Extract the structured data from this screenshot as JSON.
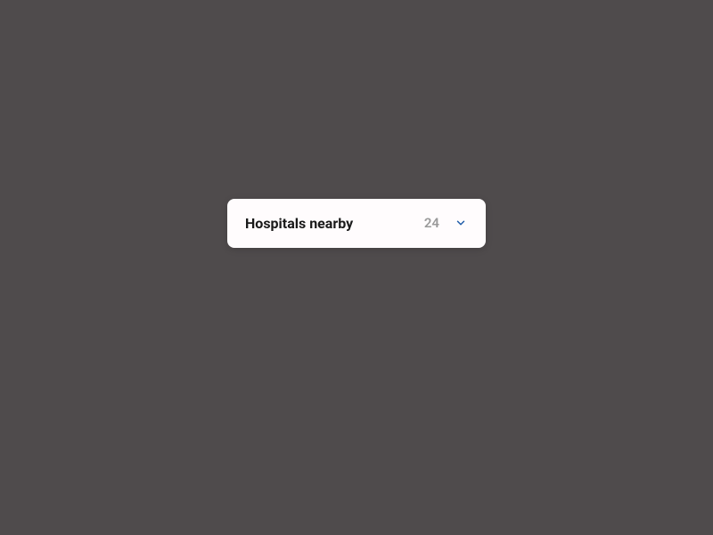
{
  "accordion": {
    "title": "Hospitals nearby",
    "count": "24"
  }
}
